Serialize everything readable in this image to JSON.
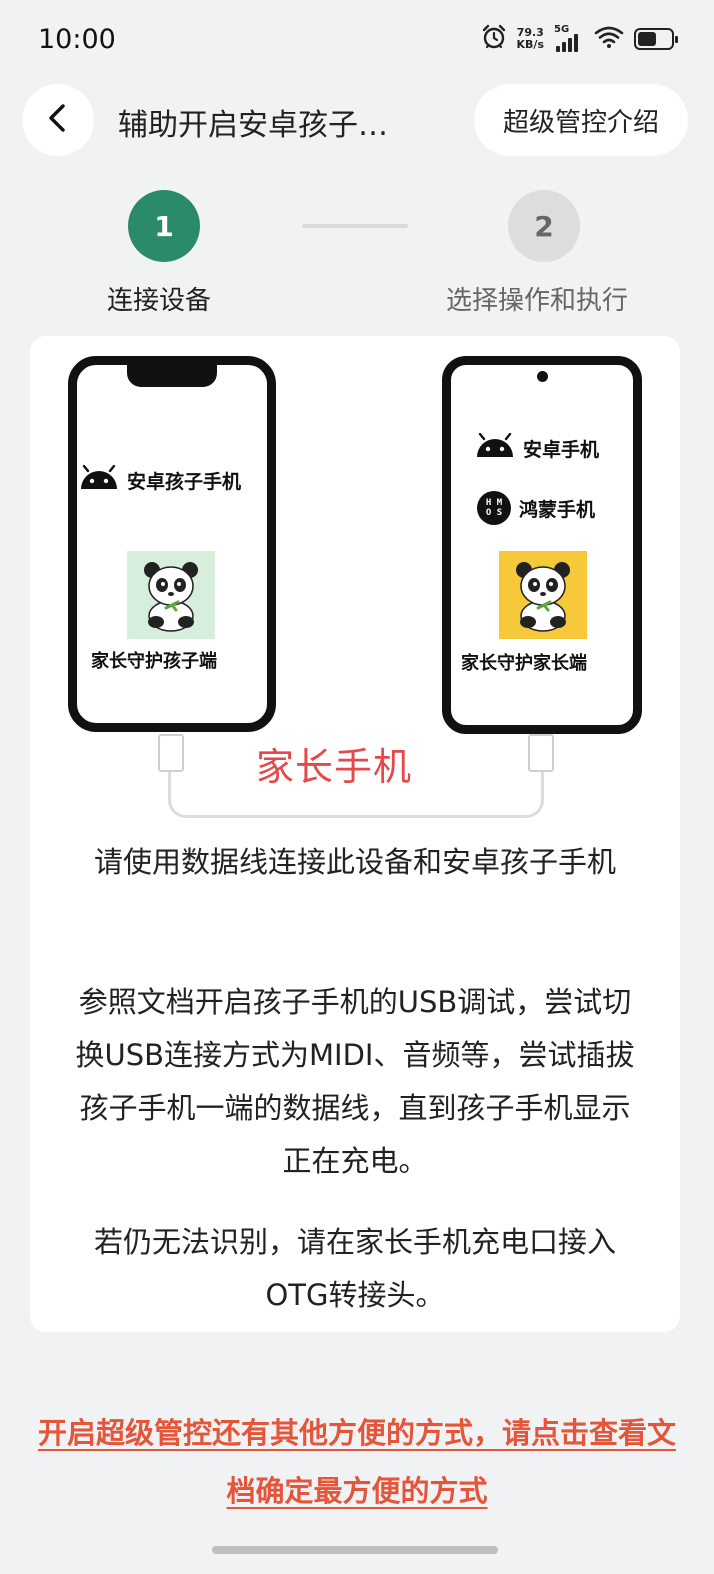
{
  "status_bar": {
    "time": "10:00",
    "net_speed_value": "79.3",
    "net_speed_unit": "KB/s",
    "network_type": "5G",
    "icons": [
      "alarm-icon",
      "signal-icon",
      "wifi-icon",
      "battery-icon"
    ],
    "battery_level": 0.55
  },
  "header": {
    "back_icon": "chevron-left-icon",
    "title": "辅助开启安卓孩子…",
    "intro_button": "超级管控介绍"
  },
  "stepper": {
    "steps": [
      {
        "number": "1",
        "label": "连接设备",
        "active": true
      },
      {
        "number": "2",
        "label": "选择操作和执行",
        "active": false
      }
    ],
    "active_color": "#2a8a6a"
  },
  "illustration": {
    "child_phone": {
      "os_label": "安卓孩子手机",
      "os_icon": "android-icon",
      "app_name": "家长守护孩子端"
    },
    "parent_phone": {
      "os_labels": [
        {
          "icon": "android-icon",
          "label": "安卓手机"
        },
        {
          "icon": "harmonyos-icon",
          "label": "鸿蒙手机",
          "logo_text": "H M\nO S"
        }
      ],
      "app_name": "家长守护家长端"
    },
    "parent_phone_label": "家长手机"
  },
  "instructions": [
    "请使用数据线连接此设备和安卓孩子手机",
    "参照文档开启孩子手机的USB调试，尝试切换USB连接方式为MIDI、音频等，尝试插拔孩子手机一端的数据线，直到孩子手机显示正在充电。",
    "若仍无法识别，请在家长手机充电口接入OTG转接头。"
  ],
  "footer": {
    "doc_link": "开启超级管控还有其他方便的方式，请点击查看文档确定最方便的方式"
  },
  "colors": {
    "accent": "#2a8a6a",
    "link": "#e4553a",
    "highlight": "#e54848",
    "background": "#f1f2f4"
  }
}
